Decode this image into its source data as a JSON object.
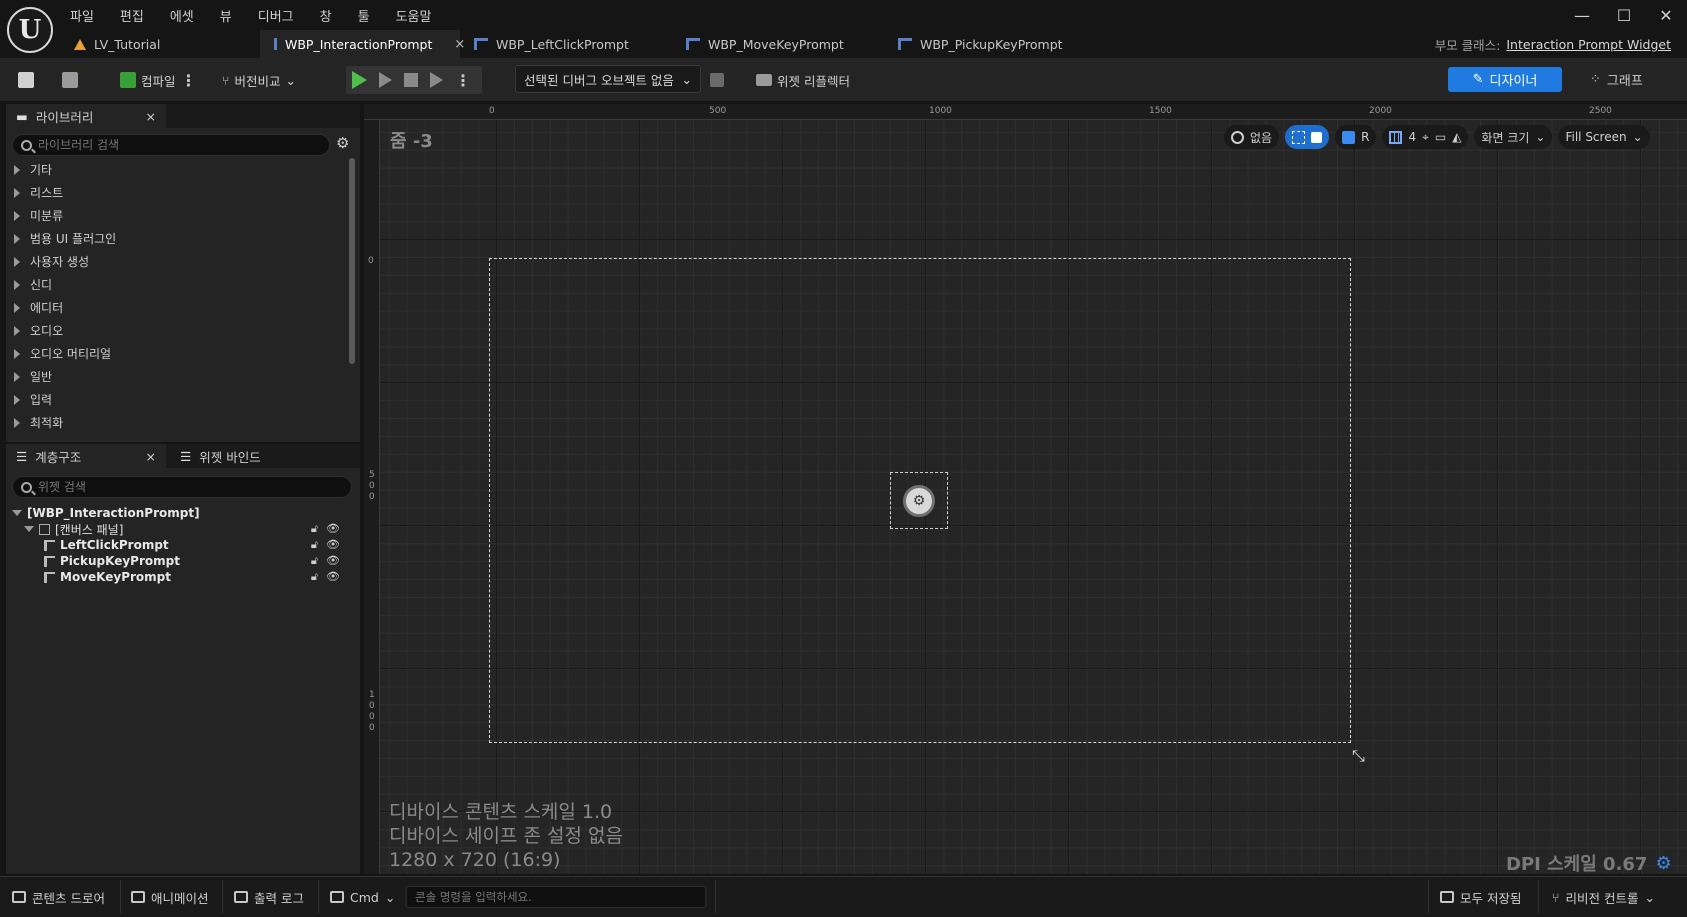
{
  "menu": [
    "파일",
    "편집",
    "에셋",
    "뷰",
    "디버그",
    "창",
    "툴",
    "도움말"
  ],
  "window_controls": {
    "minimize": "—",
    "maximize": "☐",
    "close": "✕"
  },
  "tabs": [
    {
      "label": "LV_Tutorial",
      "icon": "level-icon"
    },
    {
      "label": "WBP_InteractionPrompt",
      "icon": "widget-blueprint-icon",
      "active": true,
      "close": "×"
    },
    {
      "label": "WBP_LeftClickPrompt",
      "icon": "widget-blueprint-icon"
    },
    {
      "label": "WBP_MoveKeyPrompt",
      "icon": "widget-blueprint-icon"
    },
    {
      "label": "WBP_PickupKeyPrompt",
      "icon": "widget-blueprint-icon"
    }
  ],
  "parent_class": {
    "label": "부모 클래스:",
    "value": "Interaction Prompt Widget"
  },
  "toolbar": {
    "compile": "컴파일",
    "diff": "버전비교",
    "debug_object": "선택된 디버그 오브젝트 없음",
    "widget_reflector": "위젯 리플렉터",
    "designer": "디자이너",
    "graph": "그래프"
  },
  "library": {
    "title": "라이브러리",
    "close": "×",
    "search_placeholder": "라이브러리 검색",
    "items": [
      "기타",
      "리스트",
      "미분류",
      "범용 UI 플러그인",
      "사용자 생성",
      "신디",
      "에디터",
      "오디오",
      "오디오 머티리얼",
      "일반",
      "입력",
      "최적화"
    ]
  },
  "hierarchy": {
    "title": "계층구조",
    "close": "×",
    "bindings_tab": "위젯 바인드",
    "search_placeholder": "위젯 검색",
    "root": "[WBP_InteractionPrompt]",
    "canvas": "[캔버스 패널]",
    "children": [
      "LeftClickPrompt",
      "PickupKeyPrompt",
      "MoveKeyPrompt"
    ]
  },
  "viewport": {
    "zoom": "줌 -3",
    "ruler_top": [
      "0",
      "500",
      "1000",
      "1500",
      "2000",
      "2500"
    ],
    "ruler_left": [
      "0",
      "500",
      "1000"
    ],
    "tools": {
      "none": "없음",
      "r": "R",
      "grid_num": "4",
      "screen_size": "화면 크기",
      "fill": "Fill Screen"
    },
    "info": [
      "디바이스 콘텐츠 스케일 1.0",
      "디바이스 세이프 존 설정 없음",
      "1280 x 720 (16:9)"
    ],
    "dpi": "DPI 스케일 0.67"
  },
  "statusbar": {
    "content_drawer": "콘텐츠 드로어",
    "animation": "애니메이션",
    "output_log": "출력 로그",
    "cmd": "Cmd",
    "console_placeholder": "콘솔 명령을 입력하세요.",
    "save_all": "모두 저장됨",
    "revision": "리비전 컨트롤"
  }
}
